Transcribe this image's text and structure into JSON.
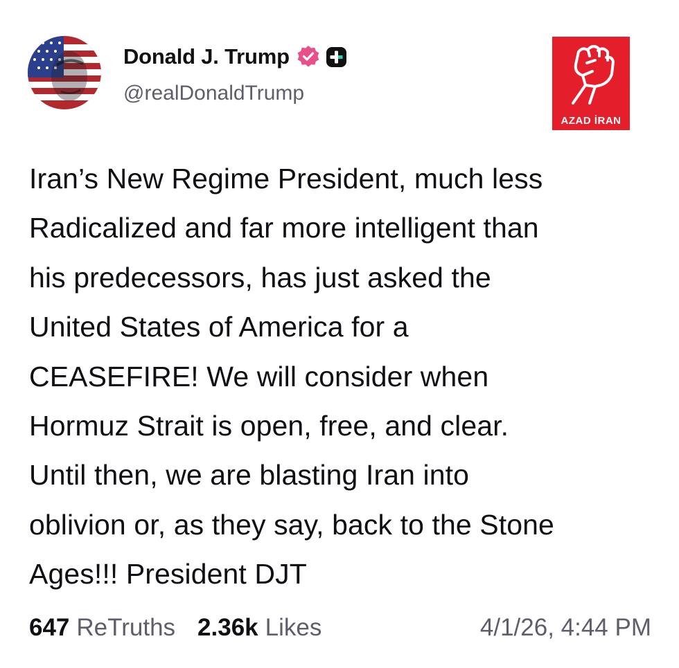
{
  "post": {
    "display_name": "Donald J. Trump",
    "handle": "@realDonaldTrump",
    "body": "Iran’s New Regime President, much less\nRadicalized and far more intelligent than\nhis predecessors, has just asked the\nUnited States of America for a\nCEASEFIRE! We will consider when\nHormuz Strait is open, free, and clear.\nUntil then, we are blasting Iran into\noblivion or, as they say, back to the Stone\nAges!!! President DJT"
  },
  "stats": {
    "retruths_count": "647",
    "retruths_label": "ReTruths",
    "likes_count": "2.36k",
    "likes_label": "Likes",
    "timestamp": "4/1/26, 4:44 PM"
  },
  "watermark": {
    "text": "AZAD İRAN"
  },
  "icons": {
    "avatar": "flag-face-avatar",
    "verified": "verified-badge-icon",
    "badge": "plus-badge-icon",
    "watermark": "raised-fist-icon"
  },
  "colors": {
    "verified_badge": "#e8508b",
    "watermark_bg": "#e41e2a",
    "secondary_text": "#5e5e6b"
  }
}
